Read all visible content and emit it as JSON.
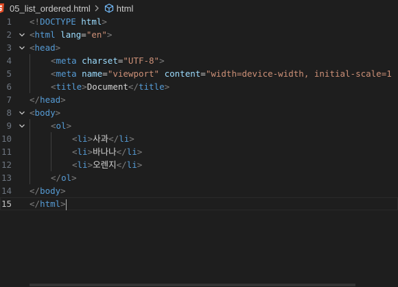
{
  "breadcrumb": {
    "filename": "05_list_ordered.html",
    "element": "html"
  },
  "colors": {
    "background": "#1e1e1e",
    "tag": "#569cd6",
    "attribute": "#9cdcfe",
    "string": "#ce9178",
    "punctuation": "#808080",
    "text": "#d4d4d4",
    "line_number": "#6e7681",
    "html_file_icon": "#e44d26"
  },
  "lines": [
    {
      "n": "1",
      "fold": "",
      "indent": 0,
      "tokens": [
        {
          "t": "punc",
          "v": "<!"
        },
        {
          "t": "tag",
          "v": "DOCTYPE"
        },
        {
          "t": "text",
          "v": " "
        },
        {
          "t": "attr",
          "v": "html"
        },
        {
          "t": "punc",
          "v": ">"
        }
      ]
    },
    {
      "n": "2",
      "fold": "v",
      "indent": 0,
      "tokens": [
        {
          "t": "punc",
          "v": "<"
        },
        {
          "t": "tag",
          "v": "html"
        },
        {
          "t": "text",
          "v": " "
        },
        {
          "t": "attr",
          "v": "lang"
        },
        {
          "t": "text",
          "v": "="
        },
        {
          "t": "str",
          "v": "\"en\""
        },
        {
          "t": "punc",
          "v": ">"
        }
      ]
    },
    {
      "n": "3",
      "fold": "v",
      "indent": 0,
      "tokens": [
        {
          "t": "punc",
          "v": "<"
        },
        {
          "t": "tag",
          "v": "head"
        },
        {
          "t": "punc",
          "v": ">"
        }
      ]
    },
    {
      "n": "4",
      "fold": "",
      "indent": 1,
      "tokens": [
        {
          "t": "punc",
          "v": "<"
        },
        {
          "t": "tag",
          "v": "meta"
        },
        {
          "t": "text",
          "v": " "
        },
        {
          "t": "attr",
          "v": "charset"
        },
        {
          "t": "text",
          "v": "="
        },
        {
          "t": "str",
          "v": "\"UTF-8\""
        },
        {
          "t": "punc",
          "v": ">"
        }
      ]
    },
    {
      "n": "5",
      "fold": "",
      "indent": 1,
      "tokens": [
        {
          "t": "punc",
          "v": "<"
        },
        {
          "t": "tag",
          "v": "meta"
        },
        {
          "t": "text",
          "v": " "
        },
        {
          "t": "attr",
          "v": "name"
        },
        {
          "t": "text",
          "v": "="
        },
        {
          "t": "str",
          "v": "\"viewport\""
        },
        {
          "t": "text",
          "v": " "
        },
        {
          "t": "attr",
          "v": "content"
        },
        {
          "t": "text",
          "v": "="
        },
        {
          "t": "str",
          "v": "\"width=device-width, initial-scale=1"
        }
      ]
    },
    {
      "n": "6",
      "fold": "",
      "indent": 1,
      "tokens": [
        {
          "t": "punc",
          "v": "<"
        },
        {
          "t": "tag",
          "v": "title"
        },
        {
          "t": "punc",
          "v": ">"
        },
        {
          "t": "text",
          "v": "Document"
        },
        {
          "t": "punc",
          "v": "</"
        },
        {
          "t": "tag",
          "v": "title"
        },
        {
          "t": "punc",
          "v": ">"
        }
      ]
    },
    {
      "n": "7",
      "fold": "",
      "indent": 0,
      "tokens": [
        {
          "t": "punc",
          "v": "</"
        },
        {
          "t": "tag",
          "v": "head"
        },
        {
          "t": "punc",
          "v": ">"
        }
      ]
    },
    {
      "n": "8",
      "fold": "v",
      "indent": 0,
      "tokens": [
        {
          "t": "punc",
          "v": "<"
        },
        {
          "t": "tag",
          "v": "body"
        },
        {
          "t": "punc",
          "v": ">"
        }
      ]
    },
    {
      "n": "9",
      "fold": "v",
      "indent": 1,
      "tokens": [
        {
          "t": "punc",
          "v": "<"
        },
        {
          "t": "tag",
          "v": "ol"
        },
        {
          "t": "punc",
          "v": ">"
        }
      ]
    },
    {
      "n": "10",
      "fold": "",
      "indent": 2,
      "tokens": [
        {
          "t": "punc",
          "v": "<"
        },
        {
          "t": "tag",
          "v": "li"
        },
        {
          "t": "punc",
          "v": ">"
        },
        {
          "t": "text",
          "v": "사과"
        },
        {
          "t": "punc",
          "v": "</"
        },
        {
          "t": "tag",
          "v": "li"
        },
        {
          "t": "punc",
          "v": ">"
        }
      ]
    },
    {
      "n": "11",
      "fold": "",
      "indent": 2,
      "tokens": [
        {
          "t": "punc",
          "v": "<"
        },
        {
          "t": "tag",
          "v": "li"
        },
        {
          "t": "punc",
          "v": ">"
        },
        {
          "t": "text",
          "v": "바나나"
        },
        {
          "t": "punc",
          "v": "</"
        },
        {
          "t": "tag",
          "v": "li"
        },
        {
          "t": "punc",
          "v": ">"
        }
      ]
    },
    {
      "n": "12",
      "fold": "",
      "indent": 2,
      "tokens": [
        {
          "t": "punc",
          "v": "<"
        },
        {
          "t": "tag",
          "v": "li"
        },
        {
          "t": "punc",
          "v": ">"
        },
        {
          "t": "text",
          "v": "오렌지"
        },
        {
          "t": "punc",
          "v": "</"
        },
        {
          "t": "tag",
          "v": "li"
        },
        {
          "t": "punc",
          "v": ">"
        }
      ]
    },
    {
      "n": "13",
      "fold": "",
      "indent": 1,
      "tokens": [
        {
          "t": "punc",
          "v": "</"
        },
        {
          "t": "tag",
          "v": "ol"
        },
        {
          "t": "punc",
          "v": ">"
        }
      ]
    },
    {
      "n": "14",
      "fold": "",
      "indent": 0,
      "tokens": [
        {
          "t": "punc",
          "v": "</"
        },
        {
          "t": "tag",
          "v": "body"
        },
        {
          "t": "punc",
          "v": ">"
        }
      ]
    },
    {
      "n": "15",
      "fold": "",
      "indent": 0,
      "current": true,
      "tokens": [
        {
          "t": "punc",
          "v": "</"
        },
        {
          "t": "tag",
          "v": "html"
        },
        {
          "t": "punc",
          "v": ">"
        }
      ]
    }
  ]
}
